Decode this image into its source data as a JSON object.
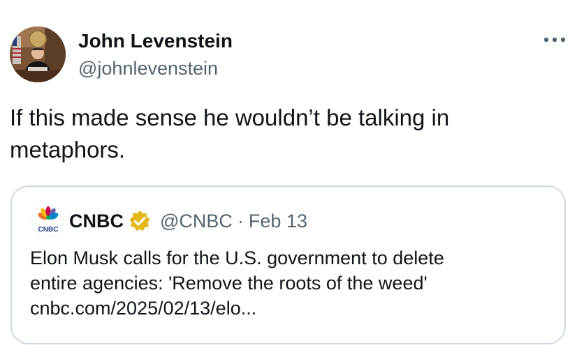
{
  "author": {
    "display_name": "John Levenstein",
    "handle": "@johnlevenstein",
    "avatar_icon": "profile-photo"
  },
  "menu": {
    "more_icon": "more-horizontal-icon"
  },
  "tweet": {
    "text": "If this made sense he wouldn’t be talking in metaphors."
  },
  "quote": {
    "display_name": "CNBC",
    "verified": true,
    "verified_color": "#e2b719",
    "handle": "@CNBC",
    "separator": "·",
    "date": "Feb 13",
    "avatar_icon": "cnbc-peacock-logo",
    "logo_text": "CNBC",
    "text_lines": [
      "Elon Musk calls for the U.S. government to delete",
      "entire agencies: 'Remove the roots of the weed'",
      "cnbc.com/2025/02/13/elo..."
    ]
  },
  "colors": {
    "text_primary": "#0f1419",
    "text_secondary": "#536471",
    "border": "#cfd9de"
  }
}
